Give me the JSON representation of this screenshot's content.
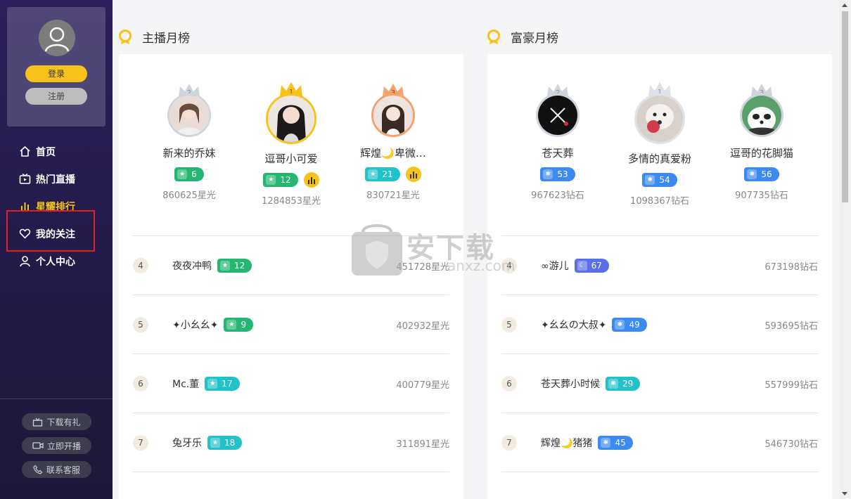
{
  "sidebar": {
    "login_label": "登录",
    "register_label": "注册",
    "nav": [
      {
        "label": "首页",
        "icon": "home-icon"
      },
      {
        "label": "热门直播",
        "icon": "tv-icon"
      },
      {
        "label": "星耀排行",
        "icon": "rank-icon",
        "active": true
      },
      {
        "label": "我的关注",
        "icon": "heart-icon"
      },
      {
        "label": "个人中心",
        "icon": "user-icon"
      }
    ],
    "bottom_buttons": [
      {
        "label": "下载有礼",
        "icon": "gift-icon"
      },
      {
        "label": "立即开播",
        "icon": "camera-icon"
      },
      {
        "label": "联系客服",
        "icon": "phone-icon"
      }
    ]
  },
  "anchor_board": {
    "title": "主播月榜",
    "top3": [
      {
        "rank": "2",
        "name": "新来的乔妹",
        "level": "6",
        "level_color": "green",
        "score": "860625星光",
        "live": false
      },
      {
        "rank": "1",
        "name": "逗哥小可爱",
        "level": "12",
        "level_color": "green",
        "score": "1284853星光",
        "live": true
      },
      {
        "rank": "3",
        "name": "辉煌🌙卑微…",
        "level": "21",
        "level_color": "teal",
        "score": "830721星光",
        "live": true
      }
    ],
    "rows": [
      {
        "rank": "4",
        "name": "夜夜冲鸭",
        "level": "12",
        "level_color": "green",
        "score": "451728星光"
      },
      {
        "rank": "5",
        "name": "✦小幺幺✦",
        "level": "9",
        "level_color": "green",
        "score": "402932星光"
      },
      {
        "rank": "6",
        "name": "Mc.董",
        "level": "17",
        "level_color": "teal",
        "score": "400779星光"
      },
      {
        "rank": "7",
        "name": "兔牙乐",
        "level": "18",
        "level_color": "teal",
        "score": "311891星光"
      }
    ]
  },
  "rich_board": {
    "title": "富豪月榜",
    "top3": [
      {
        "rank": "2",
        "name": "苍天葬",
        "level": "53",
        "level_color": "blue",
        "score": "967623钻石"
      },
      {
        "rank": "1",
        "name": "多情的真爱粉",
        "level": "54",
        "level_color": "blue",
        "score": "1098367钻石"
      },
      {
        "rank": "3",
        "name": "逗哥的花脚猫",
        "level": "56",
        "level_color": "blue",
        "score": "907735钻石"
      }
    ],
    "rows": [
      {
        "rank": "4",
        "name": "∞游儿",
        "level": "67",
        "level_color": "purple",
        "score": "673198钻石"
      },
      {
        "rank": "5",
        "name": "✦幺幺の大叔✦",
        "level": "49",
        "level_color": "blue",
        "score": "593695钻石"
      },
      {
        "rank": "6",
        "name": "苍天葬小时候",
        "level": "29",
        "level_color": "teal",
        "score": "557999钻石"
      },
      {
        "rank": "7",
        "name": "辉煌🌙猪猪",
        "level": "45",
        "level_color": "blue",
        "score": "546730钻石"
      }
    ]
  },
  "watermark": {
    "text": "安下载",
    "sub": "anxz.com"
  }
}
